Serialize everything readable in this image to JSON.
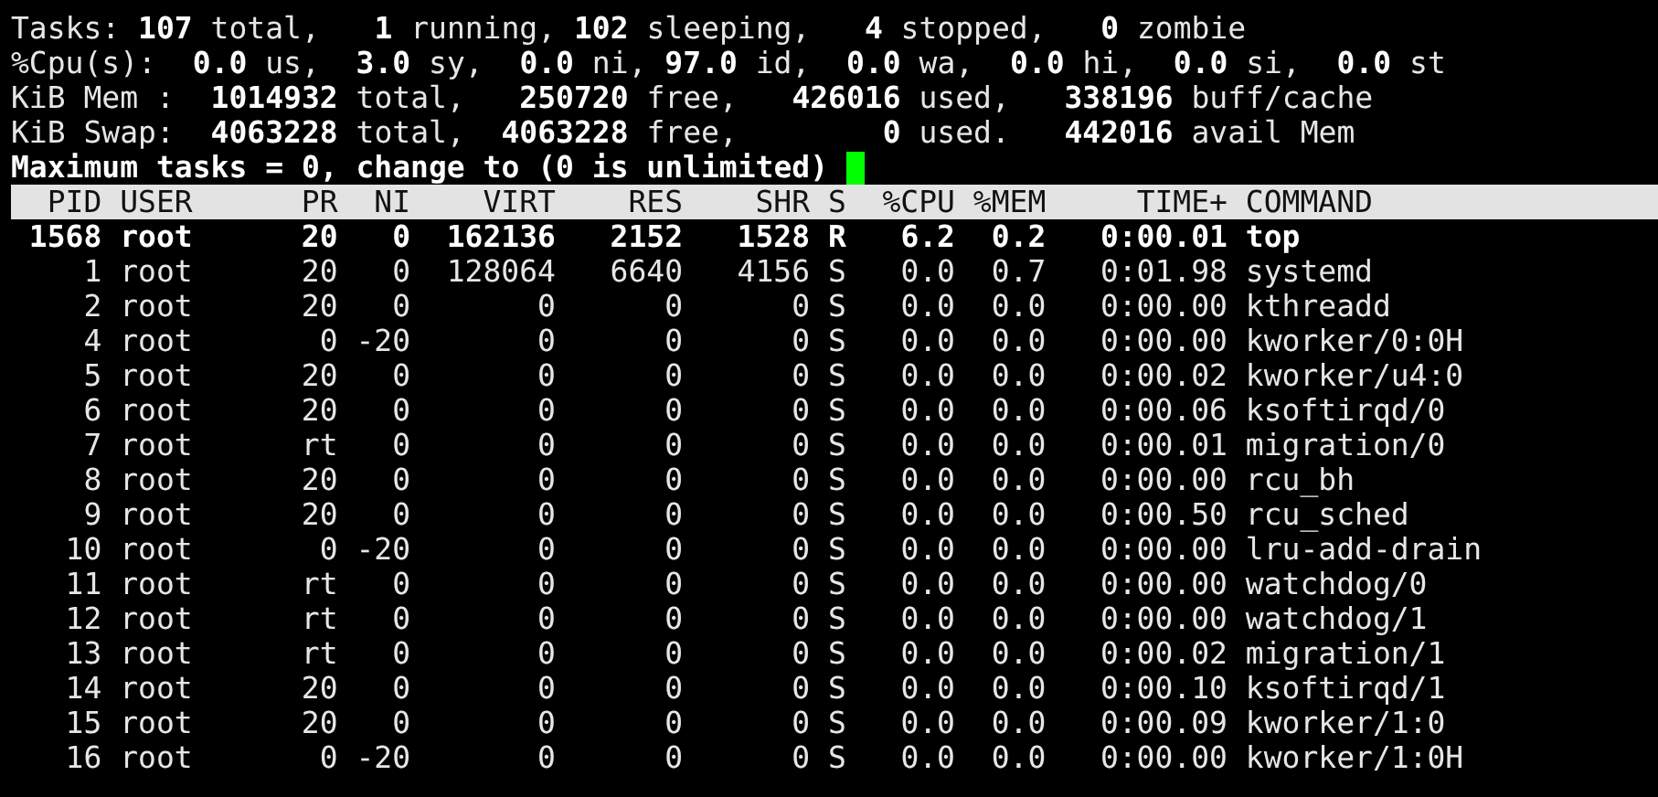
{
  "summary": [
    "Tasks: **107** total,   **1** running, **102** sleeping,   **4** stopped,   **0** zombie",
    "%Cpu(s):  **0.0** us,  **3.0** sy,  **0.0** ni, **97.0** id,  **0.0** wa,  **0.0** hi,  **0.0** si,  **0.0** st",
    "KiB Mem :  **1014932** total,   **250720** free,   **426016** used,   **338196** buff/cache",
    "KiB Swap:  **4063228** total,  **4063228** free,        **0** used.   **442016** avail Mem"
  ],
  "prompt": "Maximum tasks = 0, change to (0 is unlimited)",
  "table": {
    "columns": [
      "PID",
      "USER",
      "PR",
      "NI",
      "VIRT",
      "RES",
      "SHR",
      "S",
      "%CPU",
      "%MEM",
      "TIME+",
      "COMMAND"
    ],
    "rows": [
      {
        "running": true,
        "cells": [
          "1568",
          "root",
          "20",
          "0",
          "162136",
          "2152",
          "1528",
          "R",
          "6.2",
          "0.2",
          "0:00.01",
          "top"
        ]
      },
      {
        "running": false,
        "cells": [
          "1",
          "root",
          "20",
          "0",
          "128064",
          "6640",
          "4156",
          "S",
          "0.0",
          "0.7",
          "0:01.98",
          "systemd"
        ]
      },
      {
        "running": false,
        "cells": [
          "2",
          "root",
          "20",
          "0",
          "0",
          "0",
          "0",
          "S",
          "0.0",
          "0.0",
          "0:00.00",
          "kthreadd"
        ]
      },
      {
        "running": false,
        "cells": [
          "4",
          "root",
          "0",
          "-20",
          "0",
          "0",
          "0",
          "S",
          "0.0",
          "0.0",
          "0:00.00",
          "kworker/0:0H"
        ]
      },
      {
        "running": false,
        "cells": [
          "5",
          "root",
          "20",
          "0",
          "0",
          "0",
          "0",
          "S",
          "0.0",
          "0.0",
          "0:00.02",
          "kworker/u4:0"
        ]
      },
      {
        "running": false,
        "cells": [
          "6",
          "root",
          "20",
          "0",
          "0",
          "0",
          "0",
          "S",
          "0.0",
          "0.0",
          "0:00.06",
          "ksoftirqd/0"
        ]
      },
      {
        "running": false,
        "cells": [
          "7",
          "root",
          "rt",
          "0",
          "0",
          "0",
          "0",
          "S",
          "0.0",
          "0.0",
          "0:00.01",
          "migration/0"
        ]
      },
      {
        "running": false,
        "cells": [
          "8",
          "root",
          "20",
          "0",
          "0",
          "0",
          "0",
          "S",
          "0.0",
          "0.0",
          "0:00.00",
          "rcu_bh"
        ]
      },
      {
        "running": false,
        "cells": [
          "9",
          "root",
          "20",
          "0",
          "0",
          "0",
          "0",
          "S",
          "0.0",
          "0.0",
          "0:00.50",
          "rcu_sched"
        ]
      },
      {
        "running": false,
        "cells": [
          "10",
          "root",
          "0",
          "-20",
          "0",
          "0",
          "0",
          "S",
          "0.0",
          "0.0",
          "0:00.00",
          "lru-add-drain"
        ]
      },
      {
        "running": false,
        "cells": [
          "11",
          "root",
          "rt",
          "0",
          "0",
          "0",
          "0",
          "S",
          "0.0",
          "0.0",
          "0:00.00",
          "watchdog/0"
        ]
      },
      {
        "running": false,
        "cells": [
          "12",
          "root",
          "rt",
          "0",
          "0",
          "0",
          "0",
          "S",
          "0.0",
          "0.0",
          "0:00.00",
          "watchdog/1"
        ]
      },
      {
        "running": false,
        "cells": [
          "13",
          "root",
          "rt",
          "0",
          "0",
          "0",
          "0",
          "S",
          "0.0",
          "0.0",
          "0:00.02",
          "migration/1"
        ]
      },
      {
        "running": false,
        "cells": [
          "14",
          "root",
          "20",
          "0",
          "0",
          "0",
          "0",
          "S",
          "0.0",
          "0.0",
          "0:00.10",
          "ksoftirqd/1"
        ]
      },
      {
        "running": false,
        "cells": [
          "15",
          "root",
          "20",
          "0",
          "0",
          "0",
          "0",
          "S",
          "0.0",
          "0.0",
          "0:00.09",
          "kworker/1:0"
        ]
      },
      {
        "running": false,
        "cells": [
          "16",
          "root",
          "0",
          "-20",
          "0",
          "0",
          "0",
          "S",
          "0.0",
          "0.0",
          "0:00.00",
          "kworker/1:0H"
        ]
      }
    ]
  }
}
